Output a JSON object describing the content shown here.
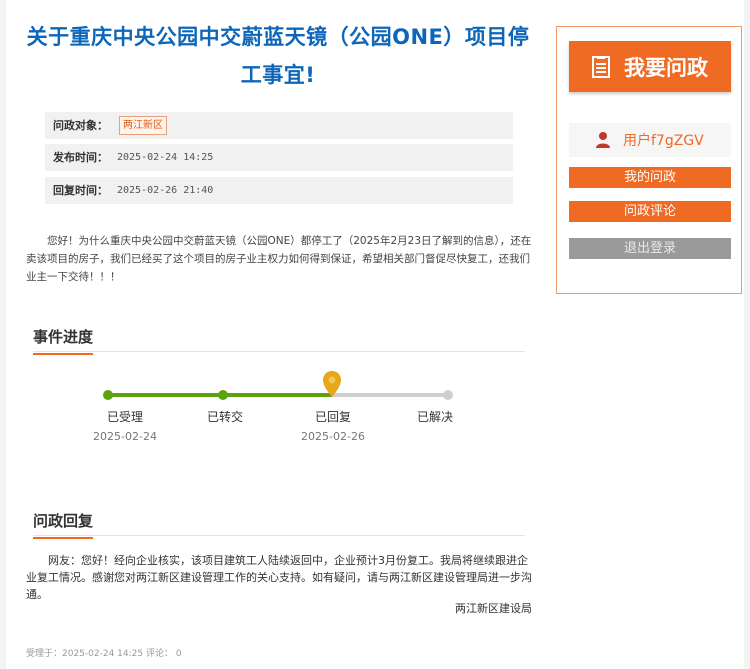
{
  "article": {
    "title": "关于重庆中央公园中交蔚蓝天镜（公园ONE）项目停工事宜!",
    "meta": {
      "target_label": "问政对象：",
      "target_tag": "两江新区",
      "published_label": "发布时间：",
      "published_value": "2025-02-24 14:25",
      "replied_label": "回复时间：",
      "replied_value": "2025-02-26 21:40"
    },
    "content": "您好！为什么重庆中央公园中交蔚蓝天镜（公园ONE）都停工了（2025年2月23日了解到的信息），还在卖该项目的房子，我们已经买了这个项目的房子业主权力如何得到保证，希望相关部门督促尽快复工，还我们业主一下交待！！！"
  },
  "progress": {
    "section_title": "事件进度",
    "current_step_index": 2,
    "steps": [
      {
        "label": "已受理",
        "date": "2025-02-24"
      },
      {
        "label": "已转交",
        "date": ""
      },
      {
        "label": "已回复",
        "date": "2025-02-26"
      },
      {
        "label": "已解决",
        "date": ""
      }
    ],
    "colors": {
      "done": "#5aa30d",
      "pending": "#cfcfcf",
      "marker": "#e8a71a"
    }
  },
  "reply": {
    "section_title": "问政回复",
    "text": "网友：您好！经向企业核实，该项目建筑工人陆续返回中，企业预计3月份复工。我局将继续跟进企业复工情况。感谢您对两江新区建设管理工作的关心支持。如有疑问，请与两江新区建设管理局进一步沟通。",
    "signature": "两江新区建设局"
  },
  "footer": {
    "text": "受理于：2025-02-24 14:25 评论： 0"
  },
  "sidebar": {
    "ask_label": "我要问政",
    "ask_icon": "document-list-icon",
    "username": "用户f7gZGV",
    "avatar_icon": "user-icon",
    "my_questions": "我的问政",
    "comments": "问政评论",
    "logout": "退出登录"
  },
  "colors": {
    "title": "#0e66b8",
    "accent": "#ef6a23",
    "tag_text": "#e05a1b"
  }
}
